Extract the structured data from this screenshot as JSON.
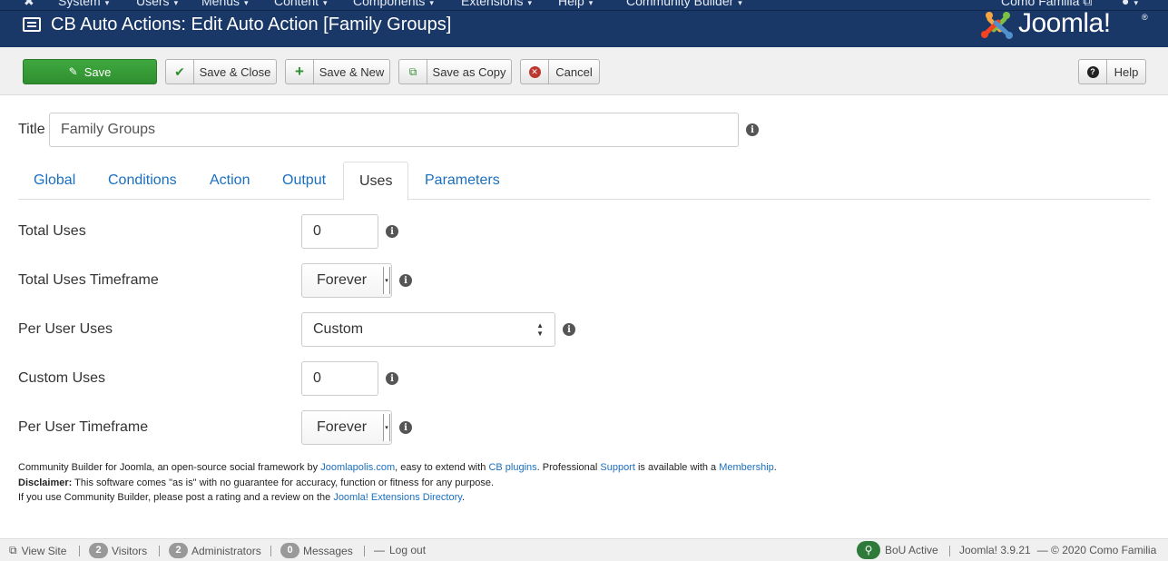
{
  "topnav": {
    "items": [
      "System",
      "Users",
      "Menus",
      "Content",
      "Components",
      "Extensions",
      "Help",
      "Community Builder"
    ],
    "user_site": "Como Familia"
  },
  "header": {
    "title": "CB Auto Actions: Edit Auto Action [Family Groups]",
    "logo_text": "Joomla!",
    "logo_reg": "®"
  },
  "toolbar": {
    "save": "Save",
    "save_close": "Save & Close",
    "save_new": "Save & New",
    "save_copy": "Save as Copy",
    "cancel": "Cancel",
    "help": "Help"
  },
  "form": {
    "title_label": "Title",
    "title_value": "Family Groups"
  },
  "tabs": [
    {
      "label": "Global"
    },
    {
      "label": "Conditions"
    },
    {
      "label": "Action"
    },
    {
      "label": "Output"
    },
    {
      "label": "Uses",
      "active": true
    },
    {
      "label": "Parameters"
    }
  ],
  "uses": {
    "total_uses_label": "Total Uses",
    "total_uses_value": "0",
    "total_uses_timeframe_label": "Total Uses Timeframe",
    "total_uses_timeframe_value": "Forever",
    "per_user_uses_label": "Per User Uses",
    "per_user_uses_value": "Custom",
    "custom_uses_label": "Custom Uses",
    "custom_uses_value": "0",
    "per_user_timeframe_label": "Per User Timeframe",
    "per_user_timeframe_value": "Forever"
  },
  "footer": {
    "line1_a": "Community Builder for Joomla, an open-source social framework by ",
    "line1_link1": "Joomlapolis.com",
    "line1_b": ", easy to extend with ",
    "line1_link2": "CB plugins",
    "line1_c": ". Professional ",
    "line1_link3": "Support",
    "line1_d": " is available with a ",
    "line1_link4": "Membership",
    "line1_e": ".",
    "line2_bold": "Disclaimer:",
    "line2_text": " This software comes \"as is\" with no guarantee for accuracy, function or fitness for any purpose.",
    "line3_a": "If you use Community Builder, please post a rating and a review on the ",
    "line3_link": "Joomla! Extensions Directory",
    "line3_b": "."
  },
  "statusbar": {
    "view_site": "View Site",
    "visitors_count": "2",
    "visitors_label": "Visitors",
    "admins_count": "2",
    "admins_label": "Administrators",
    "messages_count": "0",
    "messages_label": "Messages",
    "logout": "Log out",
    "bou_label": "BoU Active",
    "version": "Joomla! 3.9.21",
    "copyright": "— © 2020 Como Familia"
  },
  "colors": {
    "header_bg": "#1a3867",
    "save_green": "#3fa83f",
    "link_blue": "#1a6fbf",
    "cancel_red": "#bd362f"
  }
}
